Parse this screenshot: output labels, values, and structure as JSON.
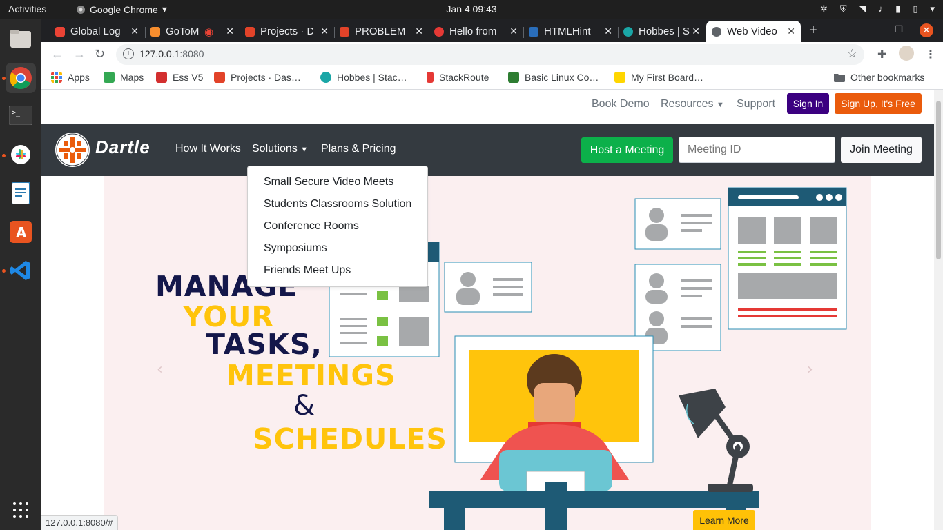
{
  "system": {
    "activities": "Activities",
    "app_name": "Google Chrome",
    "clock": "Jan 4  09:43"
  },
  "tabs": [
    {
      "title": "Global Log",
      "color": "#ea4335",
      "active": false
    },
    {
      "title": "GoToMe",
      "color": "#f68d2e",
      "active": false
    },
    {
      "title": "Projects · D",
      "color": "#e24329",
      "active": false
    },
    {
      "title": "PROBLEM",
      "color": "#e24329",
      "active": false
    },
    {
      "title": "Hello from",
      "color": "#e53935",
      "active": false
    },
    {
      "title": "HTMLHint",
      "color": "#2a6ebb",
      "active": false
    },
    {
      "title": "Hobbes | S",
      "color": "#1aa6a6",
      "active": false
    },
    {
      "title": "Web Video",
      "color": "#5f6368",
      "active": true
    }
  ],
  "address": {
    "host": "127.0.0.1",
    "port": ":8080"
  },
  "bookmarks": [
    {
      "label": "Apps",
      "color": "#4285f4"
    },
    {
      "label": "Maps",
      "color": "#34a853"
    },
    {
      "label": "Ess V5",
      "color": "#d32f2f"
    },
    {
      "label": "Projects · Das…",
      "color": "#e24329"
    },
    {
      "label": "Hobbes | Stac…",
      "color": "#1aa6a6"
    },
    {
      "label": "StackRoute",
      "color": "#e53935"
    },
    {
      "label": "Basic Linux Co…",
      "color": "#2e7d32"
    },
    {
      "label": "My First Board…",
      "color": "#ffd600"
    },
    {
      "label": "Other bookmarks",
      "color": "#5f6368"
    }
  ],
  "topnav": {
    "book_demo": "Book Demo",
    "resources": "Resources",
    "support": "Support",
    "sign_in": "Sign In",
    "sign_up": "Sign Up, It's Free"
  },
  "mainnav": {
    "brand": "Dartle",
    "how_it_works": "How It Works",
    "solutions": "Solutions",
    "plans": "Plans & Pricing",
    "host": "Host a Meeting",
    "meeting_placeholder": "Meeting ID",
    "join": "Join Meeting"
  },
  "dropdown": [
    "Small Secure Video Meets",
    "Students Classrooms Solution",
    "Conference Rooms",
    "Symposiums",
    "Friends Meet Ups"
  ],
  "hero": {
    "line1": "MANAGE",
    "line2": "YOUR",
    "line3": "TASKS,",
    "line4": "MEETINGS",
    "line5": "&",
    "line6": "SCHEDULES",
    "learn_more": "Learn More"
  },
  "status_url": "127.0.0.1:8080/#"
}
